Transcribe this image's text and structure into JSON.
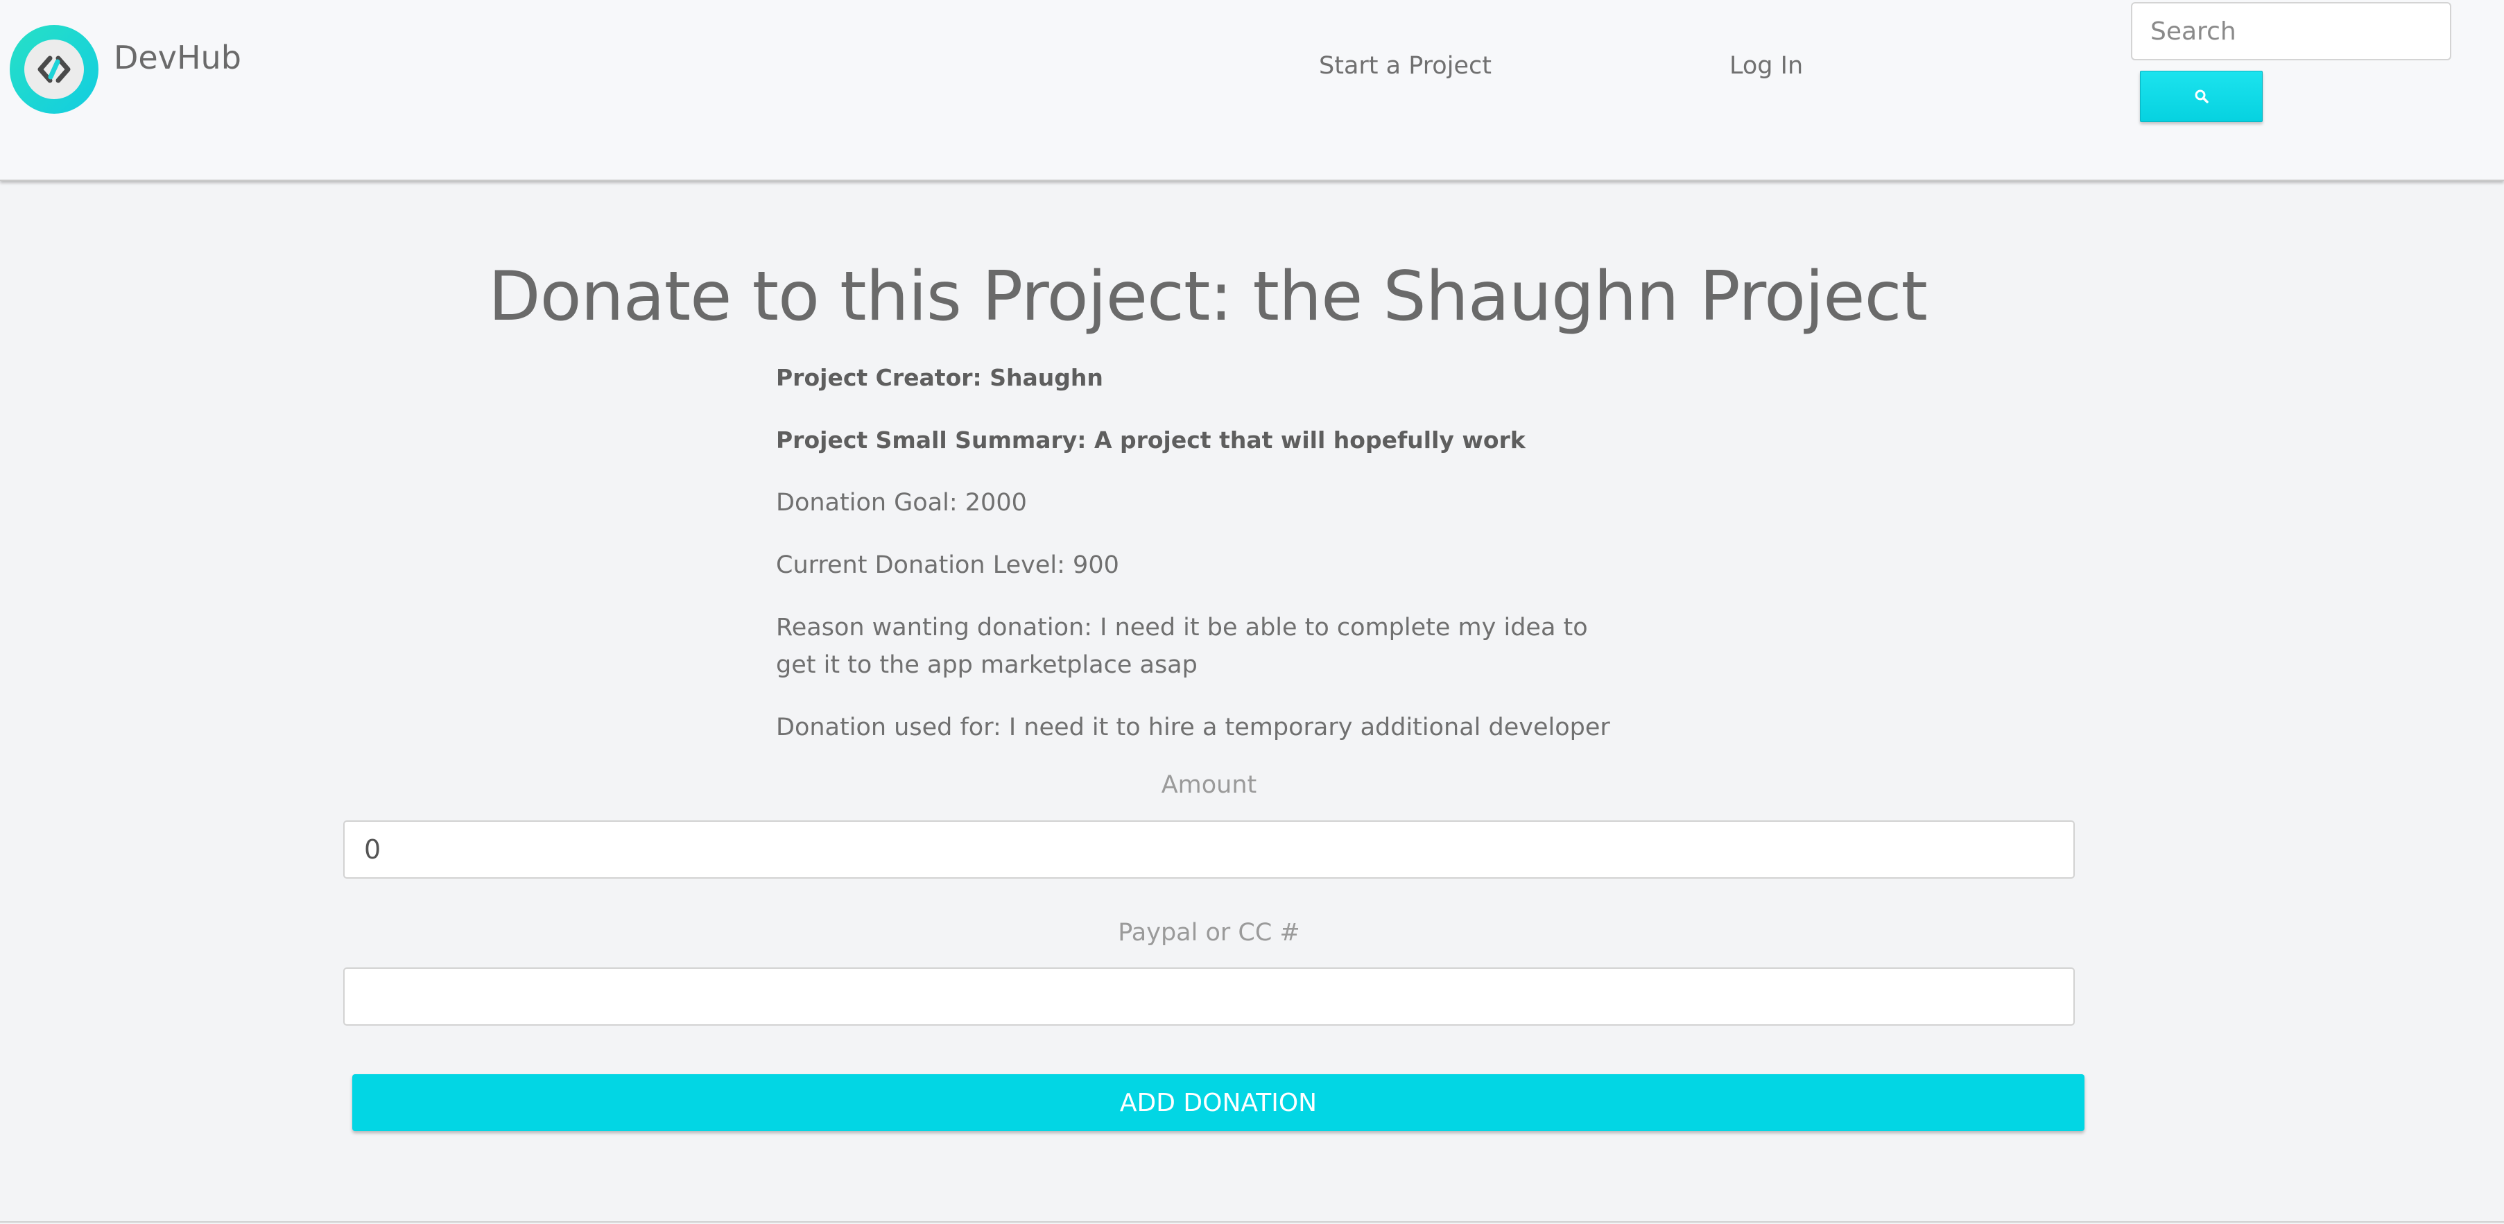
{
  "header": {
    "brand_name": "DevHub",
    "logo_icon": "code-link-icon",
    "nav": {
      "start_project": "Start a Project",
      "log_in": "Log In"
    },
    "search": {
      "placeholder": "Search",
      "button_icon": "search-icon"
    }
  },
  "main": {
    "title": "Donate to this Project: the Shaughn Project",
    "creator": "Project Creator: Shaughn",
    "summary": "Project Small Summary: A project that will hopefully work",
    "goal": "Donation Goal: 2000",
    "current_level": "Current Donation Level: 900",
    "reason": "Reason wanting donation: I need it be able to complete my idea to get it to the app marketplace asap",
    "used_for": "Donation used for: I need it to hire a temporary additional developer"
  },
  "form": {
    "amount_label": "Amount",
    "amount_value": "0",
    "payment_label": "Paypal or CC #",
    "payment_value": "",
    "submit_label": "ADD DONATION"
  },
  "colors": {
    "accent": "#02d6e4",
    "logo_gradient_start": "#27e0c6",
    "logo_gradient_end": "#12cde0",
    "background": "#f3f4f6",
    "header_background": "#f7f8fa"
  }
}
